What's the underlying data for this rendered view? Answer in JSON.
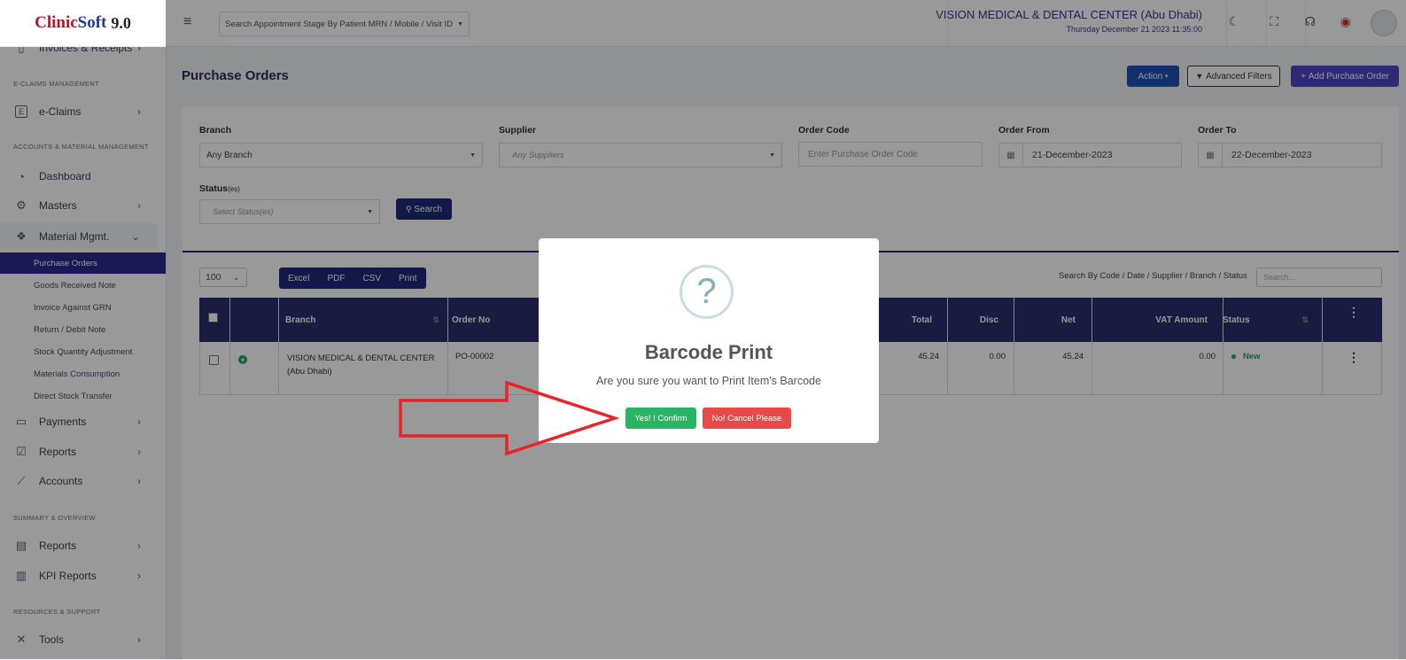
{
  "app": {
    "logo": {
      "clinic": "Clinic",
      "soft": "Soft",
      "version": "9.0"
    }
  },
  "sidebar": {
    "top_partial": {
      "label": "Invoices & Receipts",
      "icon": "receipt-icon"
    },
    "sections": {
      "eclaims": "E-CLAIMS MANAGEMENT",
      "accounts": "ACCOUNTS & MATERIAL MANAGEMENT",
      "summary": "SUMMARY & OVERVIEW",
      "resources": "RESOURCES & SUPPORT"
    },
    "items": {
      "eclaims": {
        "label": "e-Claims",
        "icon": "e-letter-icon"
      },
      "dashboard": {
        "label": "Dashboard",
        "icon": "gauge-icon"
      },
      "masters": {
        "label": "Masters",
        "icon": "gear-icon"
      },
      "material": {
        "label": "Material Mgmt.",
        "icon": "cubes-icon"
      },
      "payments": {
        "label": "Payments",
        "icon": "wallet-icon"
      },
      "reports1": {
        "label": "Reports",
        "icon": "checklist-icon"
      },
      "accounts": {
        "label": "Accounts",
        "icon": "chart-line-icon"
      },
      "reports2": {
        "label": "Reports",
        "icon": "clipboard-icon"
      },
      "kpi": {
        "label": "KPI Reports",
        "icon": "bar-chart-icon"
      },
      "tools": {
        "label": "Tools",
        "icon": "tools-icon"
      }
    },
    "material_sub": [
      "Purchase Orders",
      "Goods Received Note",
      "Invoice Against GRN",
      "Return / Debit Note",
      "Stock Quantity Adjustment",
      "Materials Consumption",
      "Direct Stock Transfer"
    ]
  },
  "header": {
    "patient_search_placeholder": "Search Appointment Stage By Patient MRN / Mobile / Visit ID",
    "clinic_name": "VISION MEDICAL & DENTAL CENTER (Abu Dhabi)",
    "datetime": "Thursday December 21 2023 11:35:00"
  },
  "page": {
    "title": "Purchase Orders",
    "action_label": "Action",
    "advanced_filters_label": "Advanced Filters",
    "add_label": "Add Purchase Order"
  },
  "filters": {
    "branch": {
      "label": "Branch",
      "value": "Any Branch"
    },
    "supplier": {
      "label": "Supplier",
      "placeholder": "Any Suppliers"
    },
    "order_code": {
      "label": "Order Code",
      "placeholder": "Enter Purchase Order Code"
    },
    "order_from": {
      "label": "Order From",
      "value": "21-December-2023"
    },
    "order_to": {
      "label": "Order To",
      "value": "22-December-2023"
    },
    "status": {
      "label": "Status",
      "label_suffix": "(es)",
      "placeholder": "Select Status(es)"
    },
    "search_label": "Search"
  },
  "table": {
    "page_size": "100",
    "exports": [
      "Excel",
      "PDF",
      "CSV",
      "Print"
    ],
    "search_label": "Search By Code / Date / Supplier / Branch / Status",
    "search_placeholder": "Search...",
    "columns": {
      "branch": "Branch",
      "order_no": "Order No",
      "total": "Total",
      "disc": "Disc",
      "net": "Net",
      "vat": "VAT Amount",
      "status": "Status"
    },
    "rows": [
      {
        "branch_line1": "VISION MEDICAL & DENTAL CENTER",
        "branch_line2": "(Abu Dhabi)",
        "order_no": "PO-00002",
        "total": "45.24",
        "disc": "0.00",
        "net": "45.24",
        "vat": "0.00",
        "status": "New"
      }
    ]
  },
  "modal": {
    "icon": "?",
    "title": "Barcode Print",
    "message": "Are you sure you want to Print Item's Barcode",
    "confirm_label": "Yes! I Confirm",
    "cancel_label": "No! Cancel Please"
  },
  "colors": {
    "primary_dark": "#2b2e6b",
    "active_sidebar": "#2e2b8c",
    "confirm": "#28b463",
    "cancel": "#e84a4a",
    "annotation_arrow": "#e8232a"
  }
}
